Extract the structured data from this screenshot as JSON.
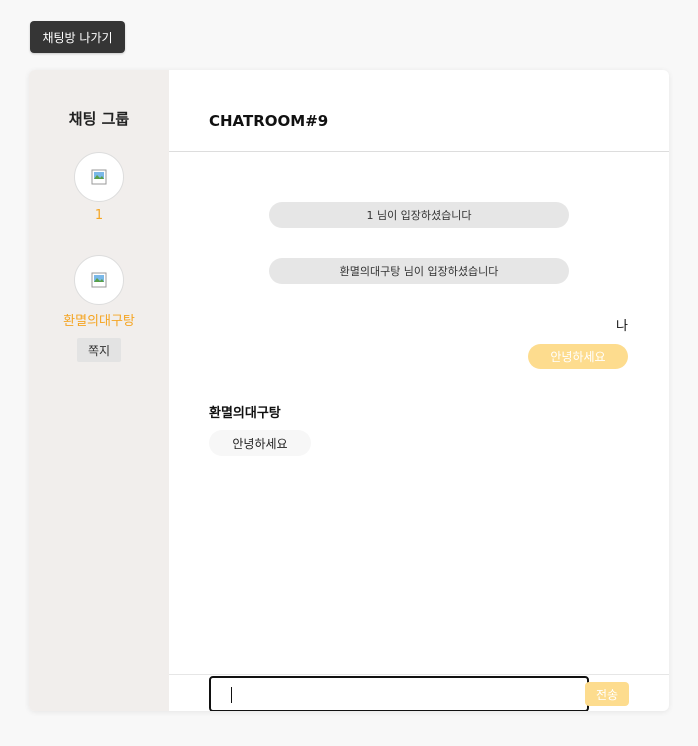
{
  "header": {
    "exit_label": "채팅방 나가기"
  },
  "sidebar": {
    "title": "채팅 그룹",
    "members": [
      {
        "name": "1"
      },
      {
        "name": "환멸의대구탕"
      }
    ],
    "note_label": "쪽지"
  },
  "chat": {
    "room_title": "CHATROOM#9",
    "system_messages": [
      "1 님이 입장하셨습니다",
      "환멸의대구탕 님이 입장하셨습니다"
    ],
    "my_label": "나",
    "my_message": "안녕하세요",
    "other_name": "환멸의대구탕",
    "other_message": "안녕하세요",
    "input_value": "",
    "send_label": "전송"
  },
  "colors": {
    "accent": "#f5a523",
    "my_bubble": "#fddc8e",
    "sidebar_bg": "#f1eeec",
    "dark_button": "#353535"
  },
  "icons": {
    "avatar": "broken-image-icon"
  }
}
